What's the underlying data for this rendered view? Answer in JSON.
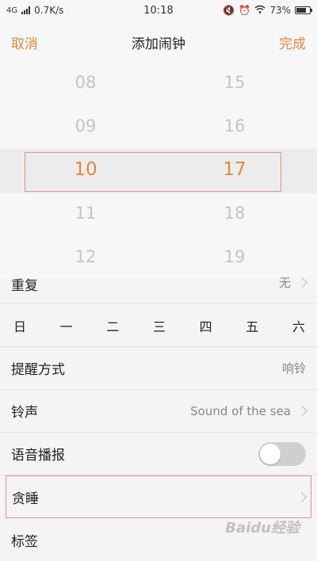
{
  "status_bar": {
    "network": "4G",
    "speed": "0.7K/s",
    "time": "10:18",
    "battery": "73%",
    "battery_level": 0.73,
    "icons": [
      "signal-icon",
      "alarm-icon",
      "mute-icon",
      "wifi-icon",
      "battery-icon"
    ]
  },
  "header": {
    "cancel": "取消",
    "title": "添加闹钟",
    "done": "完成"
  },
  "picker": {
    "hours": [
      "08",
      "09",
      "10",
      "11",
      "12"
    ],
    "minutes": [
      "15",
      "16",
      "17",
      "18",
      "19"
    ],
    "selected_hour": "10",
    "selected_minute": "17"
  },
  "list": {
    "repeat": {
      "label": "重复",
      "value": "无"
    },
    "days": [
      "日",
      "一",
      "二",
      "三",
      "四",
      "五",
      "六"
    ],
    "remind": {
      "label": "提醒方式",
      "value": "响铃"
    },
    "ringtone": {
      "label": "铃声",
      "value": "Sound of the sea"
    },
    "voice": {
      "label": "语音播报",
      "enabled": false
    },
    "snooze": {
      "label": "贪睡"
    },
    "tag": {
      "label": "标签"
    }
  },
  "watermark": "Baidu经验",
  "colors": {
    "accent": "#e08a3c",
    "highlight_border": "#e0938f"
  }
}
